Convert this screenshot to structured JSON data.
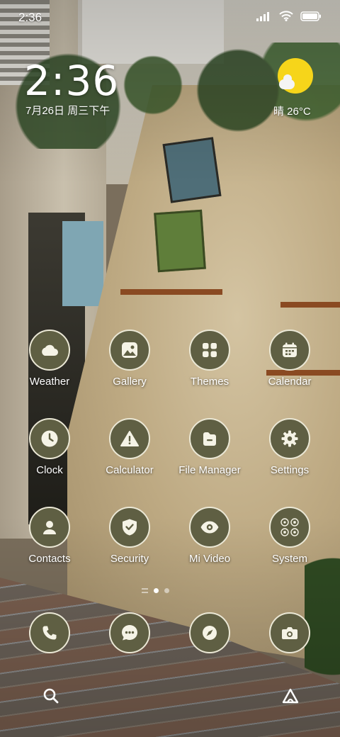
{
  "status_bar": {
    "time": "2:36",
    "icons": [
      "signal-icon",
      "wifi-icon",
      "battery-icon"
    ]
  },
  "clock_widget": {
    "time": "2:36",
    "date": "7月26日 周三下午"
  },
  "weather_widget": {
    "icon": "partly-sunny-icon",
    "text": "晴 26°C",
    "sun_color": "#f6d51a"
  },
  "theme": {
    "icon_fill": "#5f5f43",
    "icon_border": "#ebe8d6",
    "glyph_color": "#f5f3e6"
  },
  "apps": [
    {
      "label": "Weather",
      "icon": "cloud-icon"
    },
    {
      "label": "Gallery",
      "icon": "image-icon"
    },
    {
      "label": "Themes",
      "icon": "grid-icon"
    },
    {
      "label": "Calendar",
      "icon": "calendar-icon"
    },
    {
      "label": "Clock",
      "icon": "clock-icon"
    },
    {
      "label": "Calculator",
      "icon": "warning-icon"
    },
    {
      "label": "File Manager",
      "icon": "folder-icon"
    },
    {
      "label": "Settings",
      "icon": "gear-icon"
    },
    {
      "label": "Contacts",
      "icon": "person-icon"
    },
    {
      "label": "Security",
      "icon": "shield-icon"
    },
    {
      "label": "Mi Video",
      "icon": "eye-icon"
    },
    {
      "label": "System",
      "icon": "folder-grid-icon"
    }
  ],
  "page_indicator": {
    "pages": 2,
    "current": 1
  },
  "dock": [
    {
      "icon": "phone-icon"
    },
    {
      "icon": "message-icon"
    },
    {
      "icon": "compass-icon"
    },
    {
      "icon": "camera-icon"
    }
  ],
  "bottom_bar": [
    {
      "icon": "search-icon"
    },
    {
      "icon": "assistant-icon"
    }
  ]
}
